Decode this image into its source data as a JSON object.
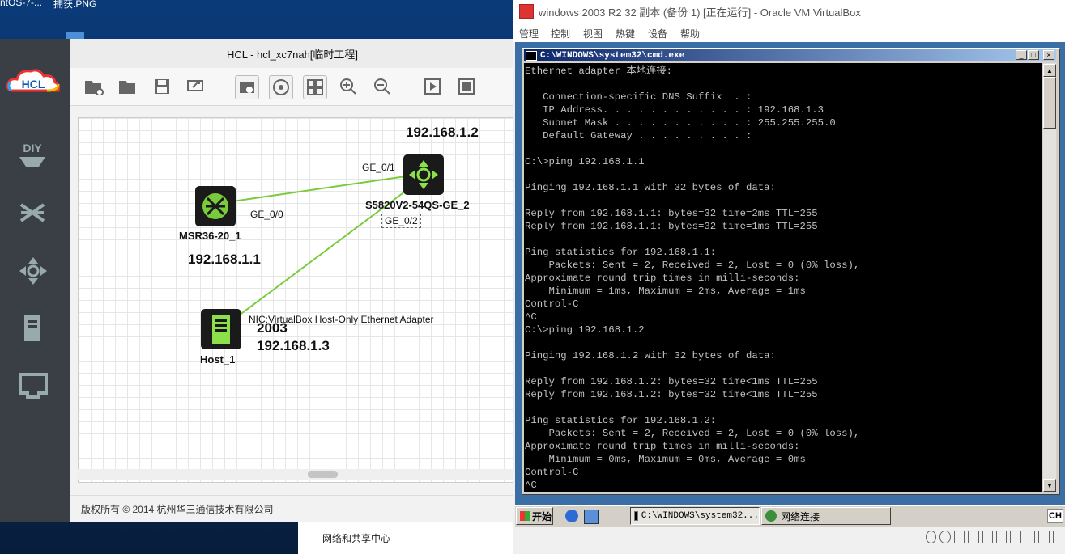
{
  "desktop": {
    "top_left_text_1": "ntOS-7-...",
    "top_left_text_2": "捕获.PNG",
    "network_center": "网络和共享中心"
  },
  "hcl": {
    "title": "HCL - hcl_xc7nah[临时工程]",
    "logo": "HCL",
    "side_items": [
      "DIY",
      "switch",
      "router",
      "server",
      "port"
    ],
    "footer": "版权所有 © 2014 杭州华三通信技术有限公司",
    "topology": {
      "devices": [
        {
          "name": "MSR36-20_1",
          "ip": "192.168.1.1",
          "port": "GE_0/0"
        },
        {
          "name": "S5820V2-54QS-GE_2",
          "ip": "192.168.1.2",
          "port_a": "GE_0/1",
          "port_b": "GE_0/2"
        },
        {
          "name": "Host_1",
          "nic": "NIC:VirtualBox Host-Only Ethernet Adapter",
          "os": "2003",
          "ip": "192.168.1.3"
        }
      ]
    }
  },
  "vbox": {
    "title": "windows 2003 R2 32 副本 (备份 1) [正在运行] - Oracle VM VirtualBox",
    "menu": [
      "管理",
      "控制",
      "视图",
      "热键",
      "设备",
      "帮助"
    ],
    "cmd_title": "C:\\WINDOWS\\system32\\cmd.exe",
    "console_lines": [
      "Ethernet adapter 本地连接:",
      "",
      "   Connection-specific DNS Suffix  . :",
      "   IP Address. . . . . . . . . . . . : 192.168.1.3",
      "   Subnet Mask . . . . . . . . . . . : 255.255.255.0",
      "   Default Gateway . . . . . . . . . :",
      "",
      "C:\\>ping 192.168.1.1",
      "",
      "Pinging 192.168.1.1 with 32 bytes of data:",
      "",
      "Reply from 192.168.1.1: bytes=32 time=2ms TTL=255",
      "Reply from 192.168.1.1: bytes=32 time=1ms TTL=255",
      "",
      "Ping statistics for 192.168.1.1:",
      "    Packets: Sent = 2, Received = 2, Lost = 0 (0% loss),",
      "Approximate round trip times in milli-seconds:",
      "    Minimum = 1ms, Maximum = 2ms, Average = 1ms",
      "Control-C",
      "^C",
      "C:\\>ping 192.168.1.2",
      "",
      "Pinging 192.168.1.2 with 32 bytes of data:",
      "",
      "Reply from 192.168.1.2: bytes=32 time<1ms TTL=255",
      "Reply from 192.168.1.2: bytes=32 time<1ms TTL=255",
      "",
      "Ping statistics for 192.168.1.2:",
      "    Packets: Sent = 2, Received = 2, Lost = 0 (0% loss),",
      "Approximate round trip times in milli-seconds:",
      "    Minimum = 0ms, Maximum = 0ms, Average = 0ms",
      "Control-C",
      "^C"
    ],
    "taskbar": {
      "start": "开始",
      "task1": "C:\\WINDOWS\\system32...",
      "task2": "网络连接",
      "tray": "CH"
    }
  }
}
